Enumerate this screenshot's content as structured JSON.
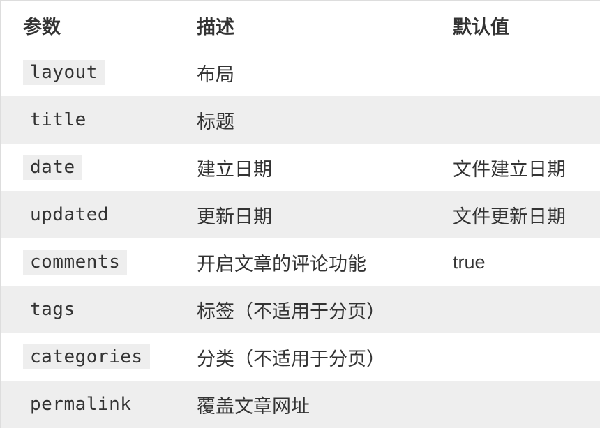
{
  "table": {
    "headers": {
      "param": "参数",
      "description": "描述",
      "default": "默认值"
    },
    "rows": [
      {
        "param": "layout",
        "description": "布局",
        "default": ""
      },
      {
        "param": "title",
        "description": "标题",
        "default": ""
      },
      {
        "param": "date",
        "description": "建立日期",
        "default": "文件建立日期"
      },
      {
        "param": "updated",
        "description": "更新日期",
        "default": "文件更新日期"
      },
      {
        "param": "comments",
        "description": "开启文章的评论功能",
        "default": "true"
      },
      {
        "param": "tags",
        "description": "标签（不适用于分页）",
        "default": ""
      },
      {
        "param": "categories",
        "description": "分类（不适用于分页）",
        "default": ""
      },
      {
        "param": "permalink",
        "description": "覆盖文章网址",
        "default": ""
      }
    ]
  },
  "colors": {
    "text": "#333333",
    "row_alt_background": "#eeeeee",
    "code_background": "#eeeeee",
    "border": "#dddddd"
  }
}
